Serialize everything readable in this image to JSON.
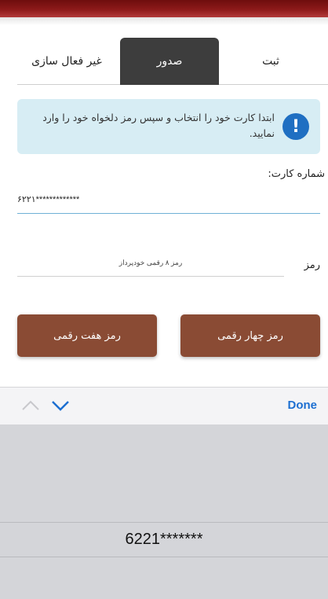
{
  "tabs": [
    {
      "label": "غیر فعال سازی",
      "active": false
    },
    {
      "label": "صدور",
      "active": true
    },
    {
      "label": "ثبت",
      "active": false
    }
  ],
  "alert": {
    "icon": "info-exclamation-icon",
    "text": "ابتدا کارت خود را انتخاب و سپس رمز دلخواه خود را وارد نمایید."
  },
  "card": {
    "label": "شماره کارت:",
    "value": "۶۲۲۱*************"
  },
  "pin": {
    "label": "رمز",
    "placeholder": "رمز ۸ رقمی خودپرداز"
  },
  "buttons": {
    "seven_digit": "رمز هفت رقمی",
    "four_digit": "رمز چهار رقمی"
  },
  "keyboard": {
    "done_label": "Done",
    "picker_value": "6221*******"
  },
  "colors": {
    "header": "#8d1a1a",
    "active_tab": "#3d3d3d",
    "alert_bg": "#d7edf4",
    "alert_icon": "#1f6fc2",
    "button": "#8a4b34",
    "done": "#1c6fd1"
  }
}
